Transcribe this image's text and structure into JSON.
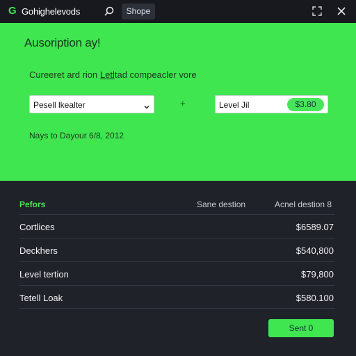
{
  "topbar": {
    "app_title": "Gohighelevods",
    "tab_label": "Shope",
    "icons": [
      "logo-icon",
      "search-icon",
      "resize-icon",
      "close-icon"
    ]
  },
  "hero": {
    "title": "Ausoription ay!",
    "subtitle_pre": "Cureeret ard ",
    "subtitle_mid": "rion ",
    "subtitle_link": "Letl",
    "subtitle_post": "tad compeacler vore",
    "select_value": "Pesell lkealter",
    "plus_sign": "+",
    "level_label": "Level Jil",
    "price": "$3.80",
    "date_text": "Nays to Dayour 6/8, 2012"
  },
  "table": {
    "headers": [
      "Pefors",
      "Sane destion",
      "Acnel destion 8"
    ],
    "rows": [
      {
        "name": "Cortlices",
        "amount": "$6589.07"
      },
      {
        "name": "Deckhers",
        "amount": "$540,800"
      },
      {
        "name": "Level tertion",
        "amount": "$79,800"
      },
      {
        "name": "Tetell Loak",
        "amount": "$580.100"
      }
    ]
  },
  "actions": {
    "sent_label": "Sent 0"
  },
  "colors": {
    "accent": "#3fe64f",
    "dark_bg": "#1f2228",
    "topbar_bg": "#17191e"
  }
}
